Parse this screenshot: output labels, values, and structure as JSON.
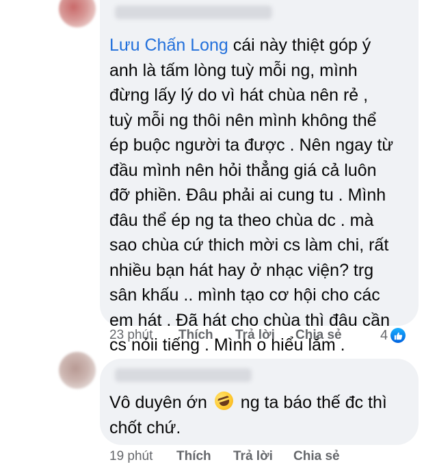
{
  "comments": [
    {
      "mention": "Lưu Chấn Long",
      "text": " cái này thiệt góp ý\nanh  là tấm lòng tuỳ mỗi ng, mình\nđừng lấy lý do vì hát chùa nên rẻ ,\ntuỳ mỗi ng thôi nên mình không thể\nép buộc người ta được . Nên ngay từ\nđầu mình nên hỏi thẳng giá cả luôn\nđỡ phiền. Đâu phải ai cung tu . Mình\nđâu thể ép ng ta theo chùa dc . mà\nsao chùa cứ thich mời cs làm chi, rất\nnhiều bạn hát hay ở nhạc viện? trg\nsân khấu .. mình tạo cơ hội cho các\nem hát . Đã hát cho chùa thì đâu cần\ncs nỏii tiếng . Mình o hiểu lắm .",
      "time": "23 phút",
      "like_label": "Thích",
      "reply_label": "Trả lời",
      "share_label": "Chia sẻ",
      "reaction_count": "4",
      "reaction_icon": "like-icon"
    },
    {
      "text_before": "Vô duyên ớn ",
      "emoji": "rolling-on-floor-laughing-emoji",
      "text_after": " ng ta báo thế đc thì\nchốt chứ.",
      "time": "19 phút",
      "like_label": "Thích",
      "reply_label": "Trả lời",
      "share_label": "Chia sẻ"
    }
  ],
  "colors": {
    "bubble": "#f0f2f5",
    "mention": "#216fdb",
    "meta": "#65676b",
    "like_blue": "#0866ff"
  }
}
